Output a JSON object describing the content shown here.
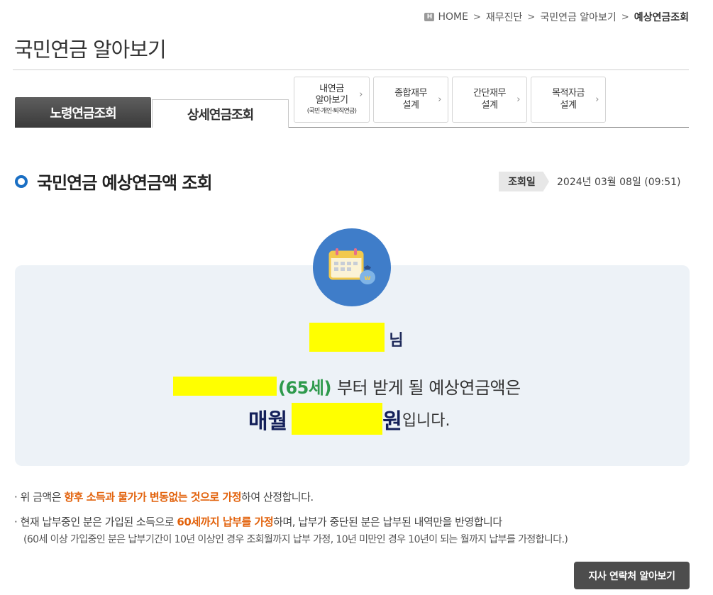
{
  "breadcrumb": {
    "home_badge": "H",
    "home": "HOME",
    "items": [
      "재무진단",
      "국민연금 알아보기"
    ],
    "current": "예상연금조회",
    "separator": ">"
  },
  "page_title": "국민연금 알아보기",
  "tabs": {
    "active": "노령연금조회",
    "inactive": "상세연금조회"
  },
  "sub_buttons": [
    {
      "line1": "내연금",
      "line2": "알아보기",
      "small": "(국민·개인·퇴직연금)"
    },
    {
      "line1": "종합재무",
      "line2": "설계"
    },
    {
      "line1": "간단재무",
      "line2": "설계"
    },
    {
      "line1": "목적자금",
      "line2": "설계"
    }
  ],
  "chevron": "›",
  "section": {
    "title": "국민연금 예상연금액 조회",
    "date_label": "조회일",
    "date_value": "2024년 03월 08일 (09:51)"
  },
  "result": {
    "name_suffix": "님",
    "age": "(65세)",
    "age_rest": "부터 받게 될 예상연금액은",
    "monthly": "매월",
    "won": "원",
    "ending": "입니다."
  },
  "notes": {
    "n1_pre": "위 금액은 ",
    "n1_hl": "향후 소득과 물가가 변동없는 것으로 가정",
    "n1_post": "하여 산정합니다.",
    "n2_pre": "현재 납부중인 분은 가입된 소득으로 ",
    "n2_hl": "60세까지 납부를 가정",
    "n2_post": "하며, 납부가 중단된 분은 납부된 내역만을 반영합니다",
    "n2_sub": "(60세 이상 가입중인 분은 납부기간이 10년 이상인 경우 조회월까지 납부 가정, 10년 미만인 경우 10년이 되는 월까지 납부를 가정합니다.)",
    "bullet": "·"
  },
  "branch_button": "지사 연락처 알아보기",
  "colors": {
    "accent_blue": "#1a6fc4",
    "highlight_orange": "#e2620c",
    "age_green": "#2e9a4c",
    "navy_text": "#14205a",
    "mask_yellow": "#ffff00"
  }
}
